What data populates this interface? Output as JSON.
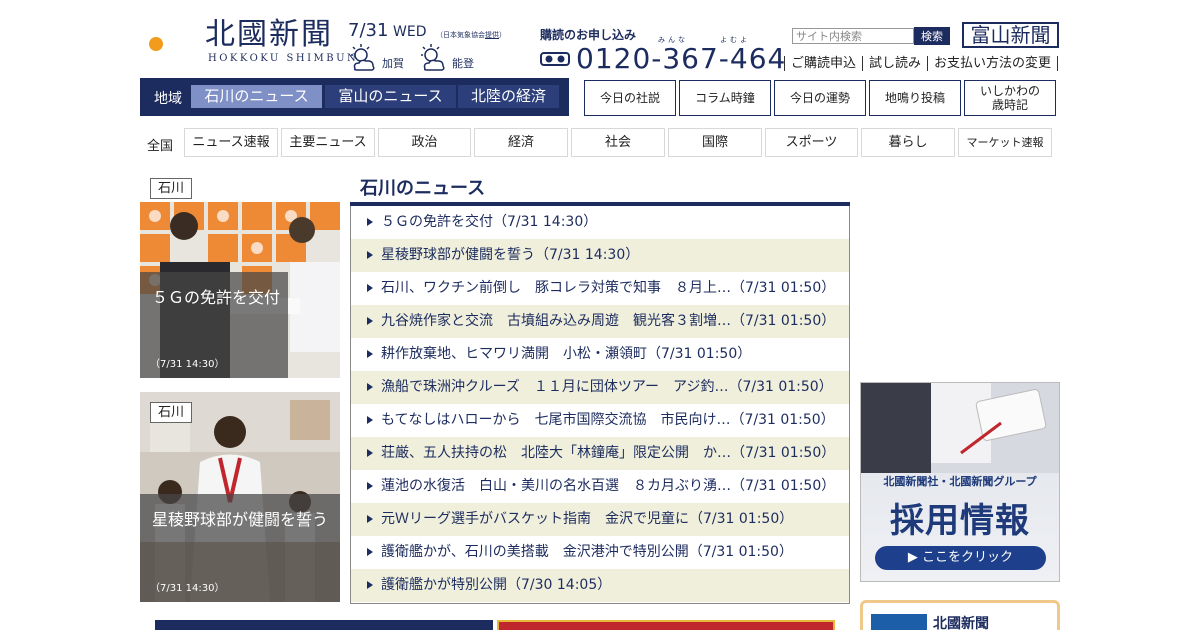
{
  "header": {
    "logo_jp": "北國新聞",
    "logo_en": "HOKKOKU SHIMBUN",
    "date": "7/31",
    "dow": "WED",
    "jma_note_pre": "（日本気象協会",
    "jma_note_link": "提供",
    "jma_note_post": "）",
    "weather": [
      {
        "place": "加賀",
        "icon": "sun-cloud-icon"
      },
      {
        "place": "能登",
        "icon": "sun-cloud-icon"
      }
    ],
    "subscribe_label": "購読のお申し込み",
    "ruby_1": "みんな",
    "ruby_2": "よむよ",
    "phone": "0120-367-464",
    "search_placeholder": "サイト内検索",
    "search_button": "検索",
    "toyama_logo": "富山新聞",
    "top_links": [
      "ご購読申込",
      "試し読み",
      "お支払い方法の変更"
    ]
  },
  "region_nav": {
    "label": "地域",
    "tabs": [
      "石川のニュース",
      "富山のニュース",
      "北陸の経済"
    ]
  },
  "column_buttons": [
    {
      "line1": "今日の社説",
      "line2": ""
    },
    {
      "line1": "コラム時鐘",
      "line2": ""
    },
    {
      "line1": "今日の運勢",
      "line2": ""
    },
    {
      "line1": "地鳴り投稿",
      "line2": ""
    },
    {
      "line1": "いしかわの",
      "line2": "歳時記"
    }
  ],
  "categories": {
    "all_label": "全国",
    "items": [
      "ニュース速報",
      "主要ニュース",
      "政治",
      "経済",
      "社会",
      "国際",
      "スポーツ",
      "暮らし",
      "マーケット速報"
    ]
  },
  "features": [
    {
      "region": "石川",
      "title": "５Ｇの免許を交付",
      "time": "（7/31 14:30）"
    },
    {
      "region": "石川",
      "title": "星稜野球部が健闘を誓う",
      "time": "（7/31 14:30）"
    }
  ],
  "news": {
    "title": "石川のニュース",
    "items": [
      "５Ｇの免許を交付（7/31 14:30）",
      "星稜野球部が健闘を誓う（7/31 14:30）",
      "石川、ワクチン前倒し　豚コレラ対策で知事　８月上…（7/31 01:50）",
      "九谷焼作家と交流　古墳組み込み周遊　観光客３割増…（7/31 01:50）",
      "耕作放棄地、ヒマワリ満開　小松・瀬領町（7/31 01:50）",
      "漁船で珠洲沖クルーズ　１１月に団体ツアー　アジ釣…（7/31 01:50）",
      "もてなしはハローから　七尾市国際交流協　市民向け…（7/31 01:50）",
      "荘厳、五人扶持の松　北陸大「林鐘庵」限定公開　か…（7/31 01:50）",
      "蓮池の水復活　白山・美川の名水百選　８カ月ぶり湧…（7/31 01:50）",
      "元Ｗリーグ選手がバスケット指南　金沢で児童に（7/31 01:50）",
      "護衛艦かが、石川の美搭載　金沢港沖で特別公開（7/31 01:50）",
      "護衛艦かが特別公開（7/30 14:05）"
    ]
  },
  "banner": {
    "company": "北國新聞社・北國新聞グループ",
    "headline": "採用情報",
    "cta": "▶ ここをクリック"
  },
  "side_box": {
    "title": "北國新聞"
  },
  "colors": {
    "navy": "#1d2c5e",
    "active_tab": "#7e90c6",
    "stripe": "#efefdc",
    "logo_orange": "#f29b1d"
  }
}
